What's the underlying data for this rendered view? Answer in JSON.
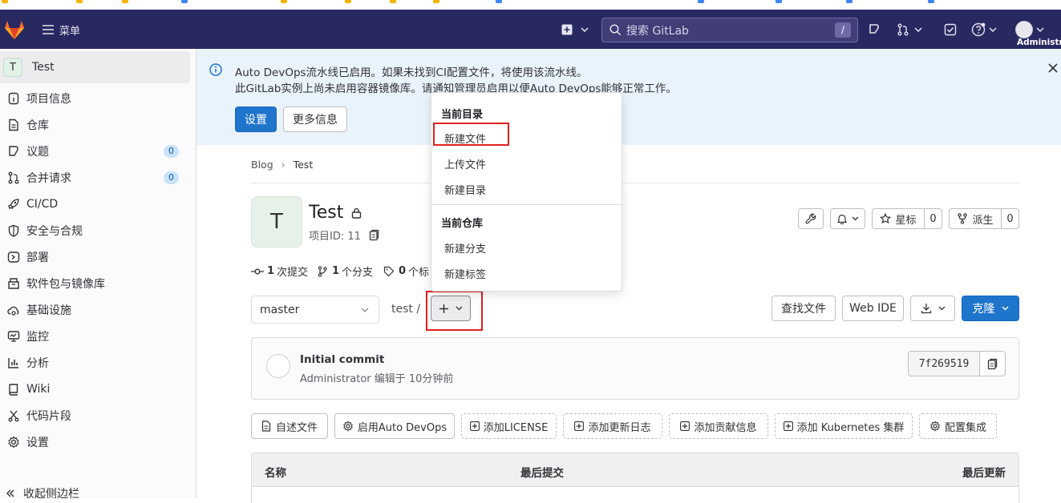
{
  "topnav": {
    "menu_label": "菜单",
    "search_placeholder": "搜索 GitLab",
    "search_shortcut": "/",
    "user_label": "Administr"
  },
  "sidebar": {
    "project_initial": "T",
    "project_name": "Test",
    "items": [
      {
        "label": "项目信息",
        "icon": "info-icon"
      },
      {
        "label": "仓库",
        "icon": "document-icon"
      },
      {
        "label": "议题",
        "icon": "issues-icon",
        "badge": "0"
      },
      {
        "label": "合并请求",
        "icon": "merge-request-icon",
        "badge": "0"
      },
      {
        "label": "CI/CD",
        "icon": "rocket-icon"
      },
      {
        "label": "安全与合规",
        "icon": "shield-icon"
      },
      {
        "label": "部署",
        "icon": "deployments-icon"
      },
      {
        "label": "软件包与镜像库",
        "icon": "package-icon"
      },
      {
        "label": "基础设施",
        "icon": "cloud-gear-icon"
      },
      {
        "label": "监控",
        "icon": "monitor-icon"
      },
      {
        "label": "分析",
        "icon": "chart-icon"
      },
      {
        "label": "Wiki",
        "icon": "book-icon"
      },
      {
        "label": "代码片段",
        "icon": "snippet-icon"
      },
      {
        "label": "设置",
        "icon": "settings-icon"
      }
    ],
    "collapse_label": "收起侧边栏"
  },
  "banner": {
    "line1": "Auto DevOps流水线已启用。如果未找到CI配置文件，将使用该流水线。",
    "line2": "此GitLab实例上尚未启用容器镜像库。请通知管理员启用以便Auto DevOps能够正常工作。",
    "settings_button": "设置",
    "more_info_button": "更多信息"
  },
  "breadcrumb": {
    "parent": "Blog",
    "separator": "›",
    "current": "Test"
  },
  "project": {
    "initial": "T",
    "title": "Test",
    "id_text": "项目ID: 11",
    "star_label": "星标",
    "star_count": "0",
    "fork_label": "派生",
    "fork_count": "0"
  },
  "stats": {
    "commits_num": "1",
    "commits_label": "次提交",
    "branches_num": "1",
    "branches_label": "个分支",
    "tags_num": "0",
    "tags_label": "个标"
  },
  "dropdown": {
    "section1": "当前目录",
    "items1": [
      "新建文件",
      "上传文件",
      "新建目录"
    ],
    "section2": "当前仓库",
    "items2": [
      "新建分支",
      "新建标签"
    ]
  },
  "repo_bar": {
    "branch": "master",
    "path": "test /",
    "find_file": "查找文件",
    "web_ide": "Web IDE",
    "clone": "克隆"
  },
  "commit": {
    "title": "Initial commit",
    "meta": "Administrator 编辑于 10分钟前",
    "sha": "7f269519"
  },
  "actions": [
    "自述文件",
    "启用Auto DevOps",
    "添加LICENSE",
    "添加更新日志",
    "添加贡献信息",
    "添加 Kubernetes 集群",
    "配置集成"
  ],
  "table": {
    "col_name": "名称",
    "col_commit": "最后提交",
    "col_updated": "最后更新"
  },
  "colors": {
    "nav": "#292961",
    "primary": "#1f75cb",
    "highlight": "#e02020",
    "banner": "#e9f3fc"
  }
}
